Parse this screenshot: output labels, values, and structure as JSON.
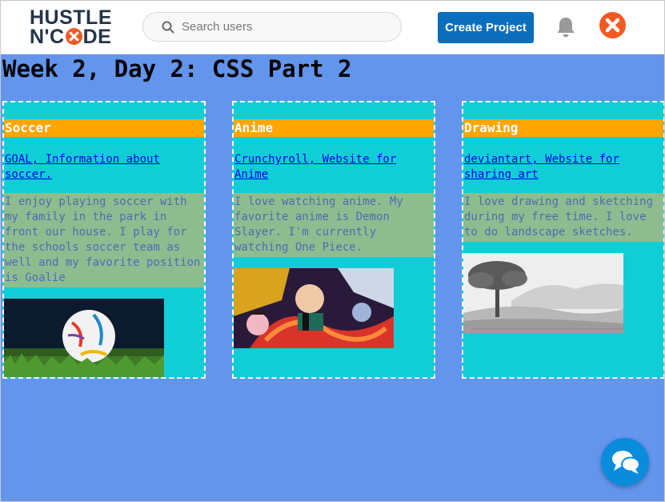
{
  "header": {
    "logo_line1": "HUSTLE",
    "logo_line2_a": "N'C",
    "logo_line2_b": "DE",
    "search_placeholder": "Search users",
    "create_button": "Create Project",
    "icons": [
      "search-icon",
      "bell-icon",
      "avatar-icon"
    ]
  },
  "main": {
    "title": "Week 2, Day 2: CSS Part 2",
    "background": "#6495ed",
    "cards": [
      {
        "title": "Soccer",
        "link": "GOAL, Information about soccer.",
        "description": "I enjoy playing soccer with my family in the park in front our house. I play for the schools soccer team as well and my favorite position is Goalie",
        "image": "soccer-ball-image"
      },
      {
        "title": "Anime",
        "link": "Crunchyroll, Website for Anime",
        "description": "I love watching anime. My favorite anime is Demon Slayer. I'm currently watching One Piece.",
        "image": "anime-image"
      },
      {
        "title": "Drawing",
        "link": "deviantart, Website for sharing art",
        "description": "I love drawing and sketching during my free time. I love to do landscape sketches.",
        "image": "landscape-sketch-image"
      }
    ]
  },
  "chat": {
    "icon": "chat-icon"
  },
  "colors": {
    "card_bg": "#11ced6",
    "card_title_bg": "#ffa500",
    "desc_bg": "#8fbc8f",
    "button": "#0a6ebd",
    "brand": "#f15a24"
  }
}
